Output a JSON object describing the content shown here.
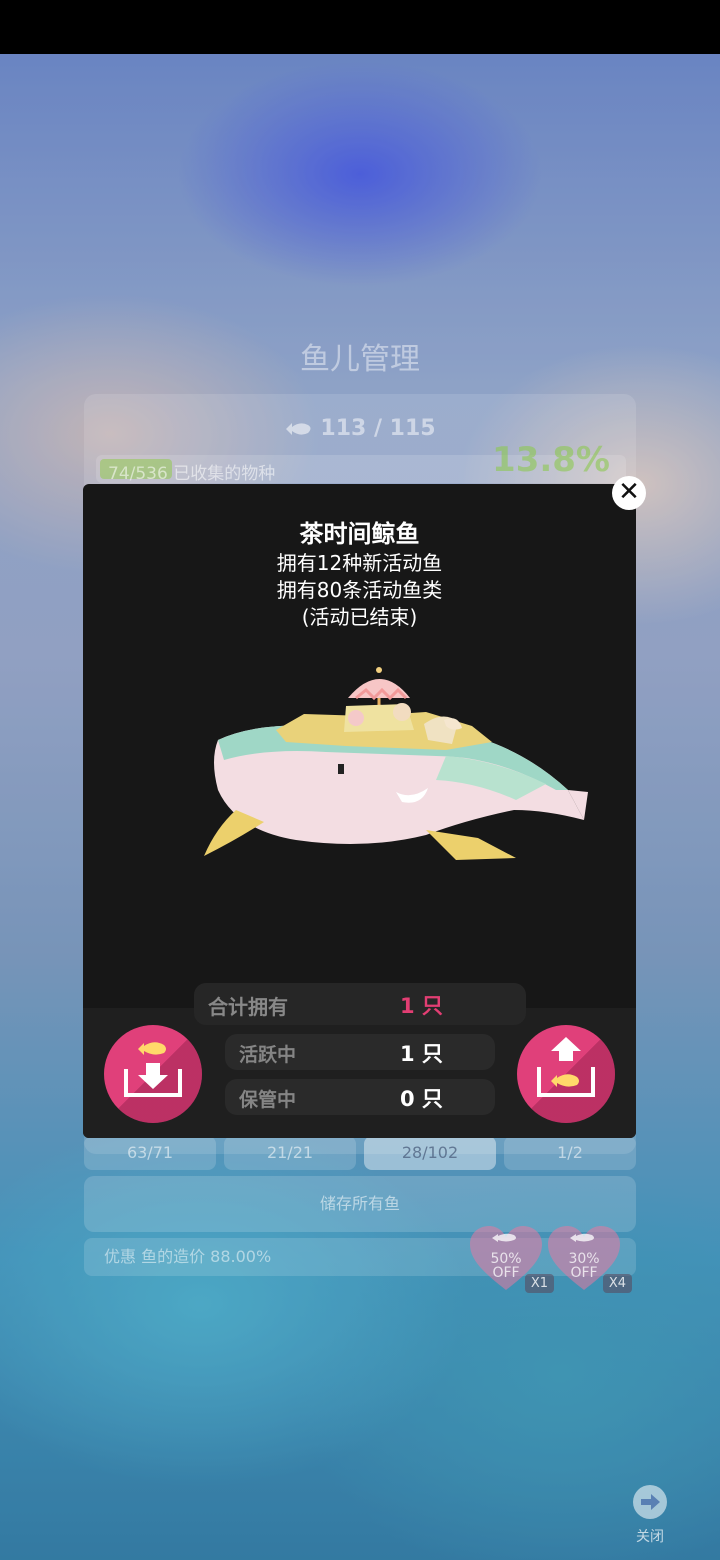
{
  "background": {
    "title": "鱼儿管理",
    "fish_count": "113 / 115",
    "collected_progress": "74/536",
    "collected_label": "已收集的物种",
    "collected_fraction": 0.138,
    "collected_percent": "13.8%",
    "tabs": [
      "63/71",
      "21/21",
      "28/102",
      "1/2"
    ],
    "active_tab_index": 2,
    "store_all_label": "储存所有鱼",
    "discount_text": "优惠 鱼的造价 88.00%",
    "boosts": [
      {
        "percent": "50%",
        "off": "OFF",
        "multiplier": "X1"
      },
      {
        "percent": "30%",
        "off": "OFF",
        "multiplier": "X4"
      }
    ],
    "close_label": "关闭"
  },
  "dialog": {
    "title": "茶时间鲸鱼",
    "line1": "拥有12种新活动鱼",
    "line2": "拥有80条活动鱼类",
    "line3": "(活动已结束)",
    "total_label": "合计拥有",
    "total_value": "1 只",
    "active_label": "活跃中",
    "active_value": "1 只",
    "stored_label": "保管中",
    "stored_value": "0 只",
    "close_icon": "close-icon",
    "store_button_icon": "fish-box-download-icon",
    "release_button_icon": "fish-box-upload-icon"
  },
  "colors": {
    "dialog_bg": "#171717",
    "accent_pink": "#e0407a",
    "total_value_color": "#e23e73"
  }
}
